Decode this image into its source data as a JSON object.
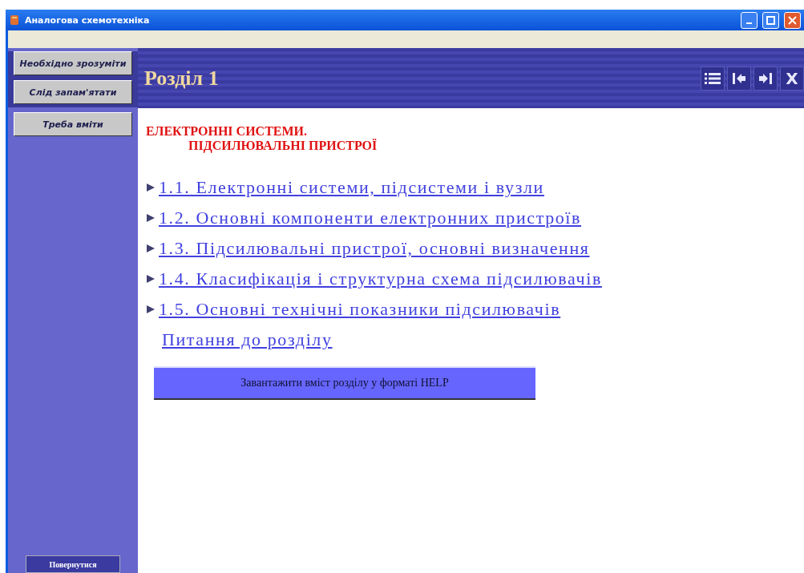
{
  "window": {
    "title": "Аналогова схемотехніка"
  },
  "sidebar": {
    "buttons": [
      {
        "label": "Необхідно зрозуміти"
      },
      {
        "label": "Слід запам'ятати"
      },
      {
        "label": "Треба вміти"
      }
    ],
    "back_button": "Повернутися"
  },
  "header": {
    "title": "Розділ 1",
    "tools": [
      {
        "kind": "contents"
      },
      {
        "kind": "first"
      },
      {
        "kind": "last"
      },
      {
        "kind": "text",
        "label": "X"
      }
    ]
  },
  "content": {
    "heading": [
      "ЕЛЕКТРОННІ СИСТЕМИ.",
      "ПІДСИЛЮВАЛЬНІ ПРИСТРОЇ"
    ],
    "links": [
      {
        "label": "1.1. Електронні системи, підсистеми і вузли",
        "bullet": true
      },
      {
        "label": "1.2. Основні компоненти електронних пристроїв",
        "bullet": true
      },
      {
        "label": "1.3. Підсилювальні пристрої, основні визначення",
        "bullet": true
      },
      {
        "label": "1.4. Класифікація і структурна схема підсилювачів",
        "bullet": true
      },
      {
        "label": "1.5. Основні технічні показники підсилювачів",
        "bullet": true
      },
      {
        "label": "Питання до розділу",
        "bullet": false
      }
    ],
    "download_button": "Завантажити вміст розділу у форматі HELP"
  }
}
